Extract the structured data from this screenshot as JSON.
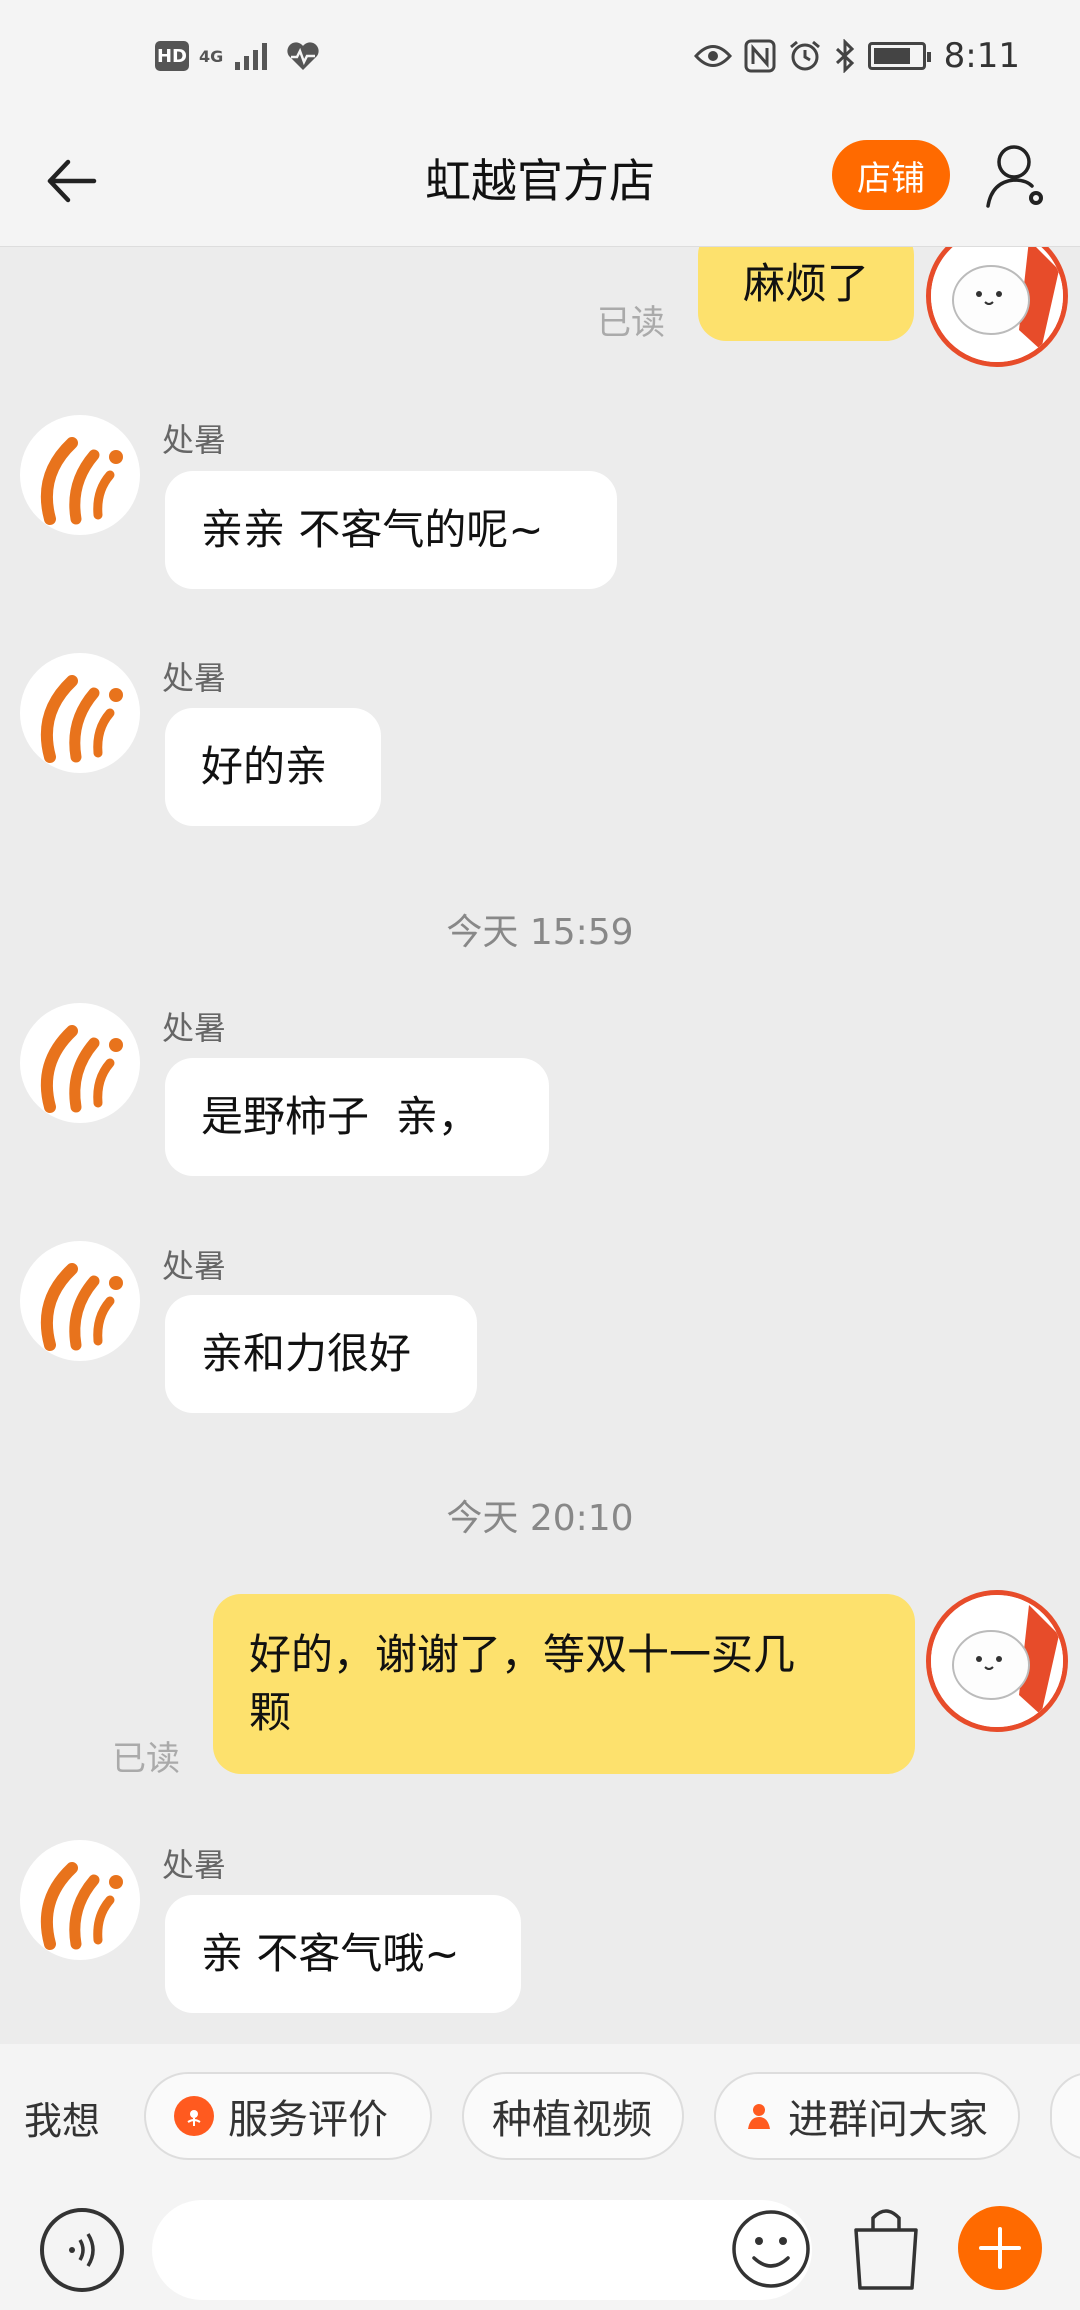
{
  "status_bar": {
    "hd_badge": "HD",
    "network": "4G",
    "time": "8:11"
  },
  "header": {
    "title": "虹越官方店",
    "shop_button": "店铺"
  },
  "chat": {
    "messages": [
      {
        "side": "right",
        "text": "麻烦了",
        "read": "已读"
      },
      {
        "side": "left",
        "sender": "处暑",
        "text": "亲亲 不客气的呢~"
      },
      {
        "side": "left",
        "sender": "处暑",
        "text": "好的亲"
      },
      {
        "timestamp": "今天  15:59"
      },
      {
        "side": "left",
        "sender": "处暑",
        "text": "是野柿子  亲，"
      },
      {
        "side": "left",
        "sender": "处暑",
        "text": "亲和力很好"
      },
      {
        "timestamp": "今天  20:10"
      },
      {
        "side": "right",
        "text_line1": "好的，谢谢了，等双十一买几",
        "text_line2": "颗",
        "read": "已读"
      },
      {
        "side": "left",
        "sender": "处暑",
        "text": "亲 不客气哦~"
      }
    ]
  },
  "suggestions": {
    "label": "我想",
    "chips": [
      {
        "label": "服务评价",
        "icon": "flower-icon"
      },
      {
        "label": "种植视频"
      },
      {
        "label": "进群问大家",
        "icon": "group-icon"
      }
    ]
  },
  "input_bar": {
    "placeholder": ""
  },
  "colors": {
    "accent": "#ff6a00",
    "bubble_mine": "#fde16d",
    "bubble_theirs": "#ffffff",
    "background": "#ececec"
  }
}
